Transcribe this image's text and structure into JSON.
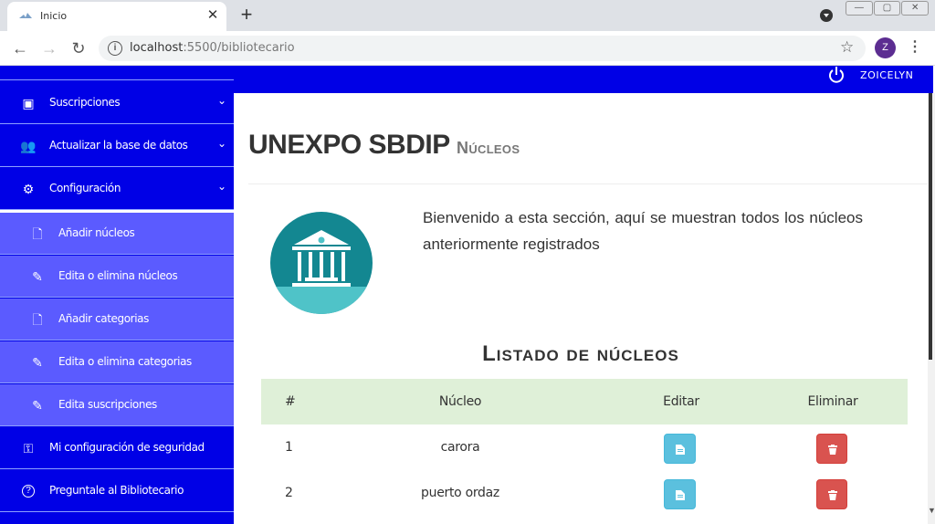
{
  "browser": {
    "tab_title": "Inicio",
    "tab_close": "✕",
    "new_tab": "+",
    "url_host": "localhost",
    "url_path": ":5500/bibliotecario",
    "profile_initial": "Z",
    "win_min": "—",
    "win_max": "▢",
    "win_close": "✕"
  },
  "sidebar": {
    "items": [
      {
        "label": "Suscripciones",
        "icon": "monitor-icon",
        "glyph": "▣",
        "caret": "⌄"
      },
      {
        "label": "Actualizar la base de datos",
        "icon": "people-icon",
        "glyph": "👥",
        "caret": "⌄"
      },
      {
        "label": "Configuración",
        "icon": "gear-icon",
        "glyph": "⚙",
        "caret": "⌄"
      },
      {
        "label": "Añadir núcleos",
        "icon": "add-file-icon",
        "glyph": "🗋"
      },
      {
        "label": "Edita o elimina núcleos",
        "icon": "pencil-icon",
        "glyph": "✎"
      },
      {
        "label": "Añadir categorias",
        "icon": "add-file-icon",
        "glyph": "🗋"
      },
      {
        "label": "Edita o elimina categorias",
        "icon": "pencil-icon",
        "glyph": "✎"
      },
      {
        "label": "Edita suscripciones",
        "icon": "pencil-icon",
        "glyph": "✎"
      },
      {
        "label": "Mi configuración de seguridad",
        "icon": "key-icon",
        "glyph": "⚿"
      },
      {
        "label": "Preguntale al Bibliotecario",
        "icon": "question-icon",
        "glyph": "?"
      }
    ]
  },
  "topbar": {
    "user": "ZOICELYN"
  },
  "header": {
    "title": "UNEXPO SBDIP",
    "subtitle": "Núcleos"
  },
  "welcome": "Bienvenido a esta sección, aquí se muestran todos los núcleos anteriormente registrados",
  "list_title": "Listado de núcleos",
  "table": {
    "columns": [
      "#",
      "Núcleo",
      "Editar",
      "Eliminar"
    ],
    "rows": [
      {
        "num": "1",
        "nucleo": "carora"
      },
      {
        "num": "2",
        "nucleo": "puerto ordaz"
      }
    ]
  },
  "colors": {
    "sidebar_primary": "#0000e6",
    "sidebar_sub": "#5b5bff",
    "table_header": "#dff0d8",
    "edit_button": "#5bc0de",
    "delete_button": "#d9534f",
    "hero_circle": "#138791"
  }
}
